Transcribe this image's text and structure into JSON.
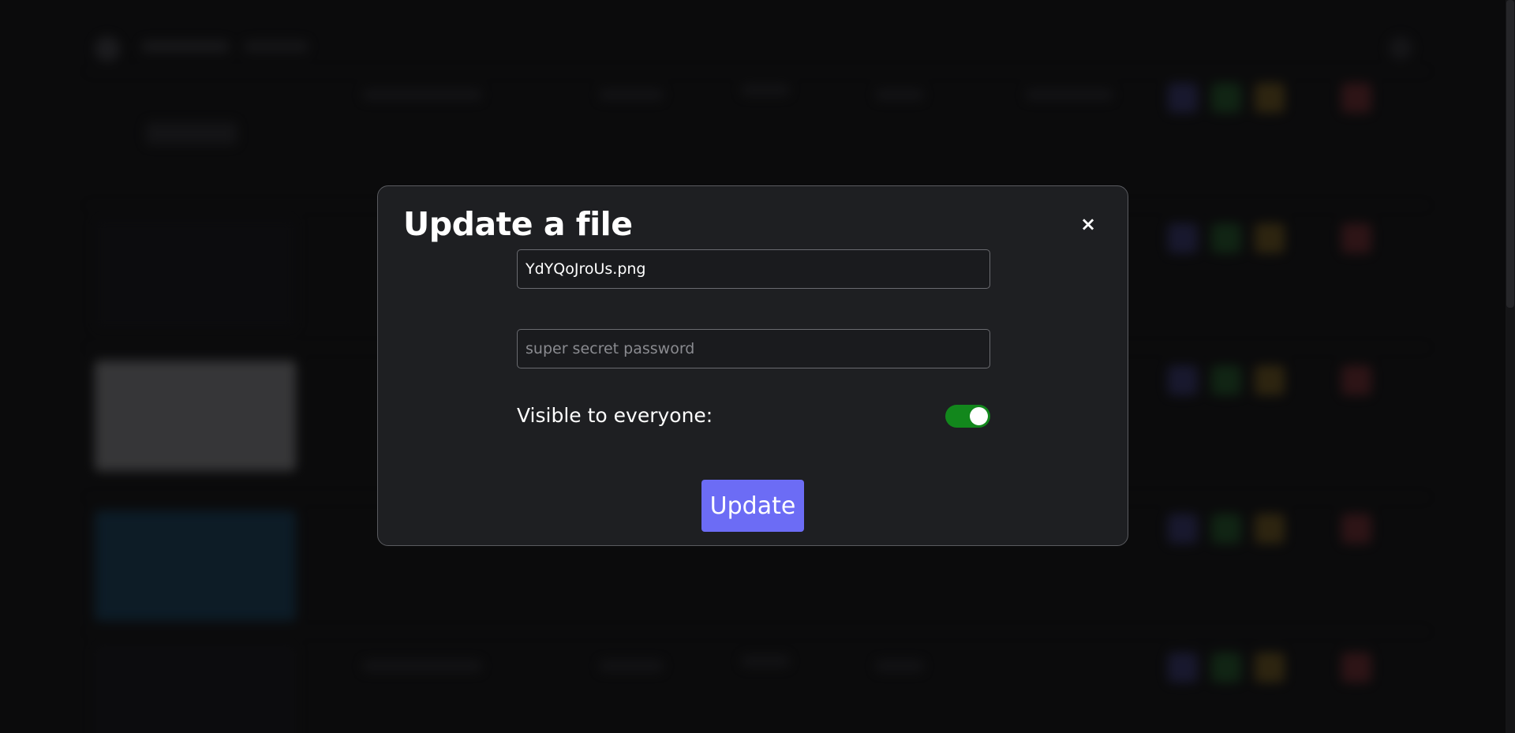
{
  "modal": {
    "title": "Update a file",
    "close_label": "×",
    "filename_value": "YdYQoJroUs.png",
    "password_placeholder": "super secret password",
    "visible_label": "Visible to everyone:",
    "visible_on": true,
    "update_label": "Update"
  },
  "colors": {
    "accent": "#6c6cf5",
    "toggle_on": "#12871c",
    "modal_bg": "#1e1f22"
  }
}
